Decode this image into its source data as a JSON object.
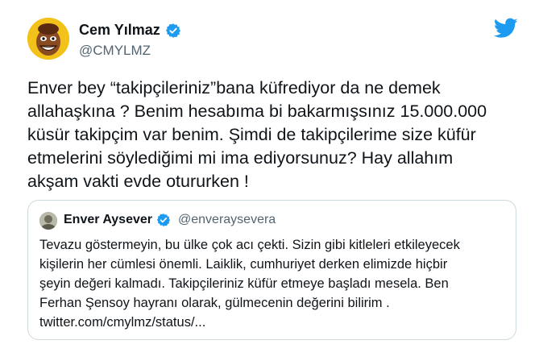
{
  "tweet": {
    "author_name": "Cem Yılmaz",
    "author_handle": "@CMYLMZ",
    "text": "Enver bey “takipçileriniz”bana küfrediyor da ne demek\nallahaşkına ? Benim hesabıma bi bakarmışsınız 15.000.000\nküsür takipçim var benim. Şimdi de takipçilerime size küfür\netmelerini söylediğimi mi ima ediyorsunuz? Hay allahım\nakşam vakti evde otururken !"
  },
  "quoted_tweet": {
    "author_name": "Enver Aysever",
    "author_handle": "@enveraysevera",
    "text": "Tevazu göstermeyin, bu ülke çok acı çekti. Sizin gibi kitleleri etkileyecek\nkişilerin her cümlesi önemli. Laiklik, cumhuriyet derken elimizde hiçbir\nşeyin değeri kalmadı. Takipçileriniz küfür etmeye başladı mesela. Ben\nFerhan Şensoy hayranı olarak, gülmecenin değerini bilirim .\ntwitter.com/cmylmz/status/..."
  },
  "icons": {
    "verified": "verified-badge-icon",
    "brand": "twitter-bird-icon"
  },
  "colors": {
    "brand_blue": "#1d9bf0",
    "text": "#0f1419",
    "secondary_text": "#536471",
    "border": "#cfd9de",
    "avatar_yellow": "#f3c21a"
  }
}
